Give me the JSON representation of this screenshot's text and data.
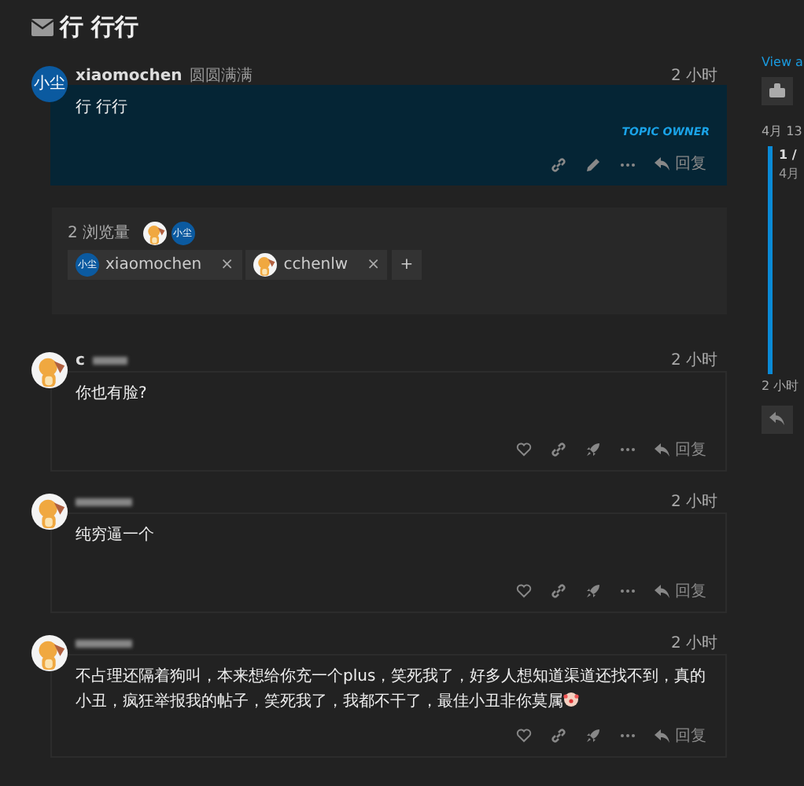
{
  "topic": {
    "title": "行 行行"
  },
  "stream": [
    {
      "kind": "post",
      "owner": true,
      "username": "xiaomochen",
      "user_title": "圆圆满满",
      "avatar": {
        "kind": "text",
        "text": "小尘"
      },
      "time": "2 小时",
      "body": "行 行行",
      "badge": "TOPIC OWNER",
      "reply": "回复"
    },
    {
      "kind": "views",
      "label": "2 浏览量",
      "viewers": [
        {
          "kind": "picture"
        },
        {
          "kind": "text",
          "text": "小尘"
        }
      ],
      "chips": [
        {
          "name": "xiaomochen",
          "avatar": {
            "kind": "text",
            "text": "小尘"
          },
          "remove": "×"
        },
        {
          "name": "cchenlw",
          "avatar": {
            "kind": "picture"
          },
          "remove": "×"
        }
      ],
      "add": "+"
    },
    {
      "kind": "post",
      "owner": false,
      "username": "c",
      "username_blurred": true,
      "avatar": {
        "kind": "picture"
      },
      "time": "2 小时",
      "body": "你也有脸?",
      "reply": "回复"
    },
    {
      "kind": "post",
      "owner": false,
      "username_blurred": true,
      "avatar": {
        "kind": "picture"
      },
      "time": "2 小时",
      "body": "纯穷逼一个",
      "reply": "回复"
    },
    {
      "kind": "post",
      "owner": false,
      "username_blurred": true,
      "avatar": {
        "kind": "picture"
      },
      "time": "2 小时",
      "body": "不占理还隔着狗叫，本来想给你充一个plus，笑死我了，好多人想知道渠道还找不到，真的小丑，疯狂举报我的帖子，笑死我了，我都不干了，最佳小丑非你莫属",
      "emoji": true,
      "reply": "回复"
    }
  ],
  "sidebar": {
    "view_as": "View a",
    "date": "4月 13",
    "progress": "1 /",
    "progress_date": "4月",
    "last_time": "2 小时"
  }
}
